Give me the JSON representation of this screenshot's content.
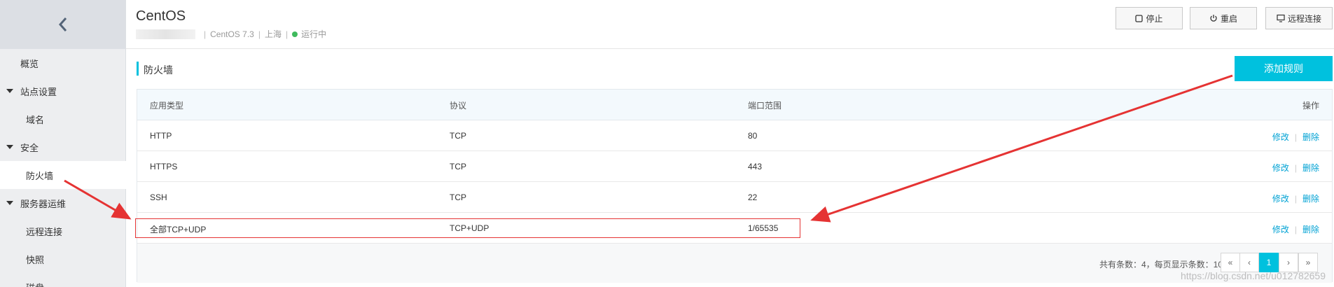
{
  "sidebar": {
    "back_icon": "chevron-left-icon",
    "items": [
      {
        "label": "概览",
        "kind": "top"
      },
      {
        "label": "站点设置",
        "kind": "group"
      },
      {
        "label": "域名",
        "kind": "sub"
      },
      {
        "label": "安全",
        "kind": "group"
      },
      {
        "label": "防火墙",
        "kind": "sub",
        "active": true
      },
      {
        "label": "服务器运维",
        "kind": "group"
      },
      {
        "label": "远程连接",
        "kind": "sub"
      },
      {
        "label": "快照",
        "kind": "sub"
      },
      {
        "label": "磁盘",
        "kind": "sub"
      }
    ]
  },
  "header": {
    "title": "CentOS",
    "os": "CentOS 7.3",
    "region": "上海",
    "status": "运行中",
    "status_color": "#3fba5d",
    "buttons": {
      "stop": "停止",
      "restart": "重启",
      "remote": "远程连接"
    }
  },
  "section": {
    "title": "防火墙",
    "add_button": "添加规则",
    "accent_color": "#00c1de"
  },
  "table": {
    "columns": [
      "应用类型",
      "协议",
      "端口范围",
      "操作"
    ],
    "rows": [
      {
        "app": "HTTP",
        "protocol": "TCP",
        "ports": "80",
        "edit": "修改",
        "delete": "删除"
      },
      {
        "app": "HTTPS",
        "protocol": "TCP",
        "ports": "443",
        "edit": "修改",
        "delete": "删除"
      },
      {
        "app": "SSH",
        "protocol": "TCP",
        "ports": "22",
        "edit": "修改",
        "delete": "删除"
      },
      {
        "app": "全部TCP+UDP",
        "protocol": "TCP+UDP",
        "ports": "1/65535",
        "edit": "修改",
        "delete": "删除"
      }
    ]
  },
  "pagination": {
    "info": "共有条数：4，每页显示条数：10",
    "first": "«",
    "prev": "‹",
    "current": "1",
    "next": "›",
    "last": "»"
  },
  "watermark": "https://blog.csdn.net/u012782659"
}
